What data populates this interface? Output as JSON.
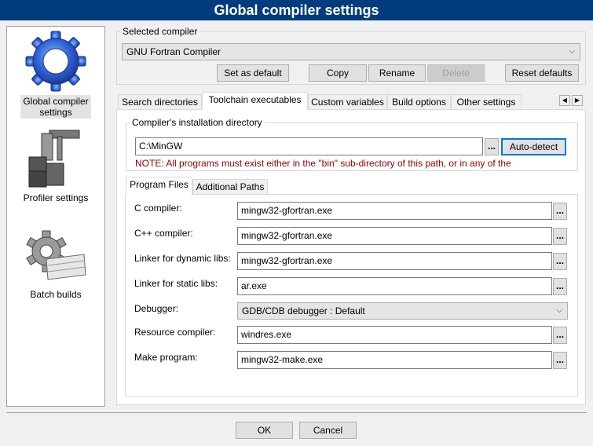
{
  "window": {
    "title": "Global compiler settings"
  },
  "sidebar": {
    "items": [
      {
        "label": "Global compiler settings",
        "icon": "gear-icon",
        "selected": true
      },
      {
        "label": "Profiler settings",
        "icon": "profiler-icon",
        "selected": false
      },
      {
        "label": "Batch builds",
        "icon": "batch-builds-icon",
        "selected": false
      }
    ]
  },
  "selected_compiler": {
    "group_label": "Selected compiler",
    "value": "GNU Fortran Compiler",
    "buttons": {
      "set_default": "Set as default",
      "copy": "Copy",
      "rename": "Rename",
      "delete": "Delete",
      "reset": "Reset defaults"
    }
  },
  "tabs": [
    {
      "label": "Search directories",
      "active": false
    },
    {
      "label": "Toolchain executables",
      "active": true
    },
    {
      "label": "Custom variables",
      "active": false
    },
    {
      "label": "Build options",
      "active": false
    },
    {
      "label": "Other settings",
      "active": false
    }
  ],
  "installation": {
    "group_label": "Compiler's installation directory",
    "path": "C:\\MinGW",
    "dots": "...",
    "auto_detect": "Auto-detect",
    "note": "NOTE: All programs must exist either in the \"bin\" sub-directory of this path, or in any of the"
  },
  "subtabs": [
    {
      "label": "Program Files",
      "active": true
    },
    {
      "label": "Additional Paths",
      "active": false
    }
  ],
  "programs": {
    "c_compiler": {
      "label": "C compiler:",
      "value": "mingw32-gfortran.exe"
    },
    "cpp_compiler": {
      "label": "C++ compiler:",
      "value": "mingw32-gfortran.exe"
    },
    "linker_dynamic": {
      "label": "Linker for dynamic libs:",
      "value": "mingw32-gfortran.exe"
    },
    "linker_static": {
      "label": "Linker for static libs:",
      "value": "ar.exe"
    },
    "debugger": {
      "label": "Debugger:",
      "value": "GDB/CDB debugger : Default"
    },
    "resource_compiler": {
      "label": "Resource compiler:",
      "value": "windres.exe"
    },
    "make_program": {
      "label": "Make program:",
      "value": "mingw32-make.exe"
    }
  },
  "footer": {
    "ok": "OK",
    "cancel": "Cancel"
  },
  "colors": {
    "titlebar": "#003c7e",
    "note": "#8b0000",
    "focus": "#0078d7"
  }
}
